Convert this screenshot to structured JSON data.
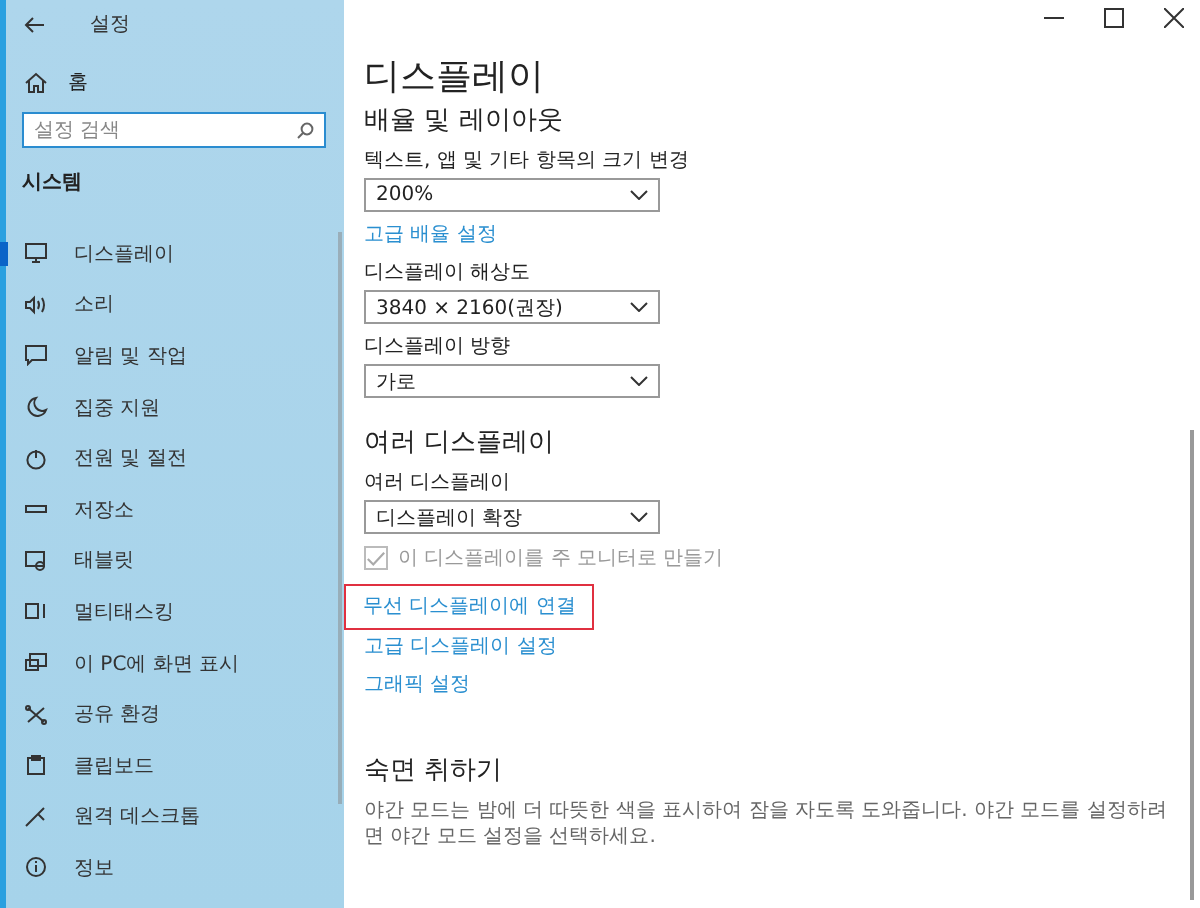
{
  "window": {
    "title": "설정"
  },
  "sidebar": {
    "home": "홈",
    "search": {
      "placeholder": "설정 검색"
    },
    "section": "시스템",
    "items": [
      {
        "label": "디스플레이",
        "selected": true
      },
      {
        "label": "소리",
        "selected": false
      },
      {
        "label": "알림 및 작업",
        "selected": false
      },
      {
        "label": "집중 지원",
        "selected": false
      },
      {
        "label": "전원 및 절전",
        "selected": false
      },
      {
        "label": "저장소",
        "selected": false
      },
      {
        "label": "태블릿",
        "selected": false
      },
      {
        "label": "멀티태스킹",
        "selected": false
      },
      {
        "label": "이 PC에 화면 표시",
        "selected": false
      },
      {
        "label": "공유 환경",
        "selected": false
      },
      {
        "label": "클립보드",
        "selected": false
      },
      {
        "label": "원격 데스크톱",
        "selected": false
      },
      {
        "label": "정보",
        "selected": false
      }
    ]
  },
  "page": {
    "title": "디스플레이",
    "sections": [
      {
        "heading": "배율 및 레이아웃",
        "controls": [
          {
            "kind": "dropdown",
            "label": "텍스트, 앱 및 기타 항목의 크기 변경",
            "value": "200%"
          },
          {
            "kind": "link",
            "text": "고급 배율 설정",
            "highlighted": false
          },
          {
            "kind": "dropdown",
            "label": "디스플레이 해상도",
            "value": "3840 × 2160(권장)"
          },
          {
            "kind": "dropdown",
            "label": "디스플레이 방향",
            "value": "가로"
          }
        ]
      },
      {
        "heading": "여러 디스플레이",
        "controls": [
          {
            "kind": "dropdown",
            "label": "여러 디스플레이",
            "value": "디스플레이 확장"
          },
          {
            "kind": "checkbox",
            "text": "이 디스플레이를 주 모니터로 만들기",
            "checked": true,
            "disabled": true
          },
          {
            "kind": "link",
            "text": "무선 디스플레이에 연결",
            "highlighted": true
          },
          {
            "kind": "link",
            "text": "고급 디스플레이 설정",
            "highlighted": false
          },
          {
            "kind": "link",
            "text": "그래픽 설정",
            "highlighted": false
          }
        ]
      },
      {
        "heading": "숙면 취하기",
        "controls": [
          {
            "kind": "text",
            "text": "야간 모드는 밤에 더 따뜻한 색을 표시하여 잠을 자도록 도와줍니다. 야간 모드를 설정하려면 야간 모드 설정을 선택하세요."
          }
        ]
      }
    ]
  }
}
